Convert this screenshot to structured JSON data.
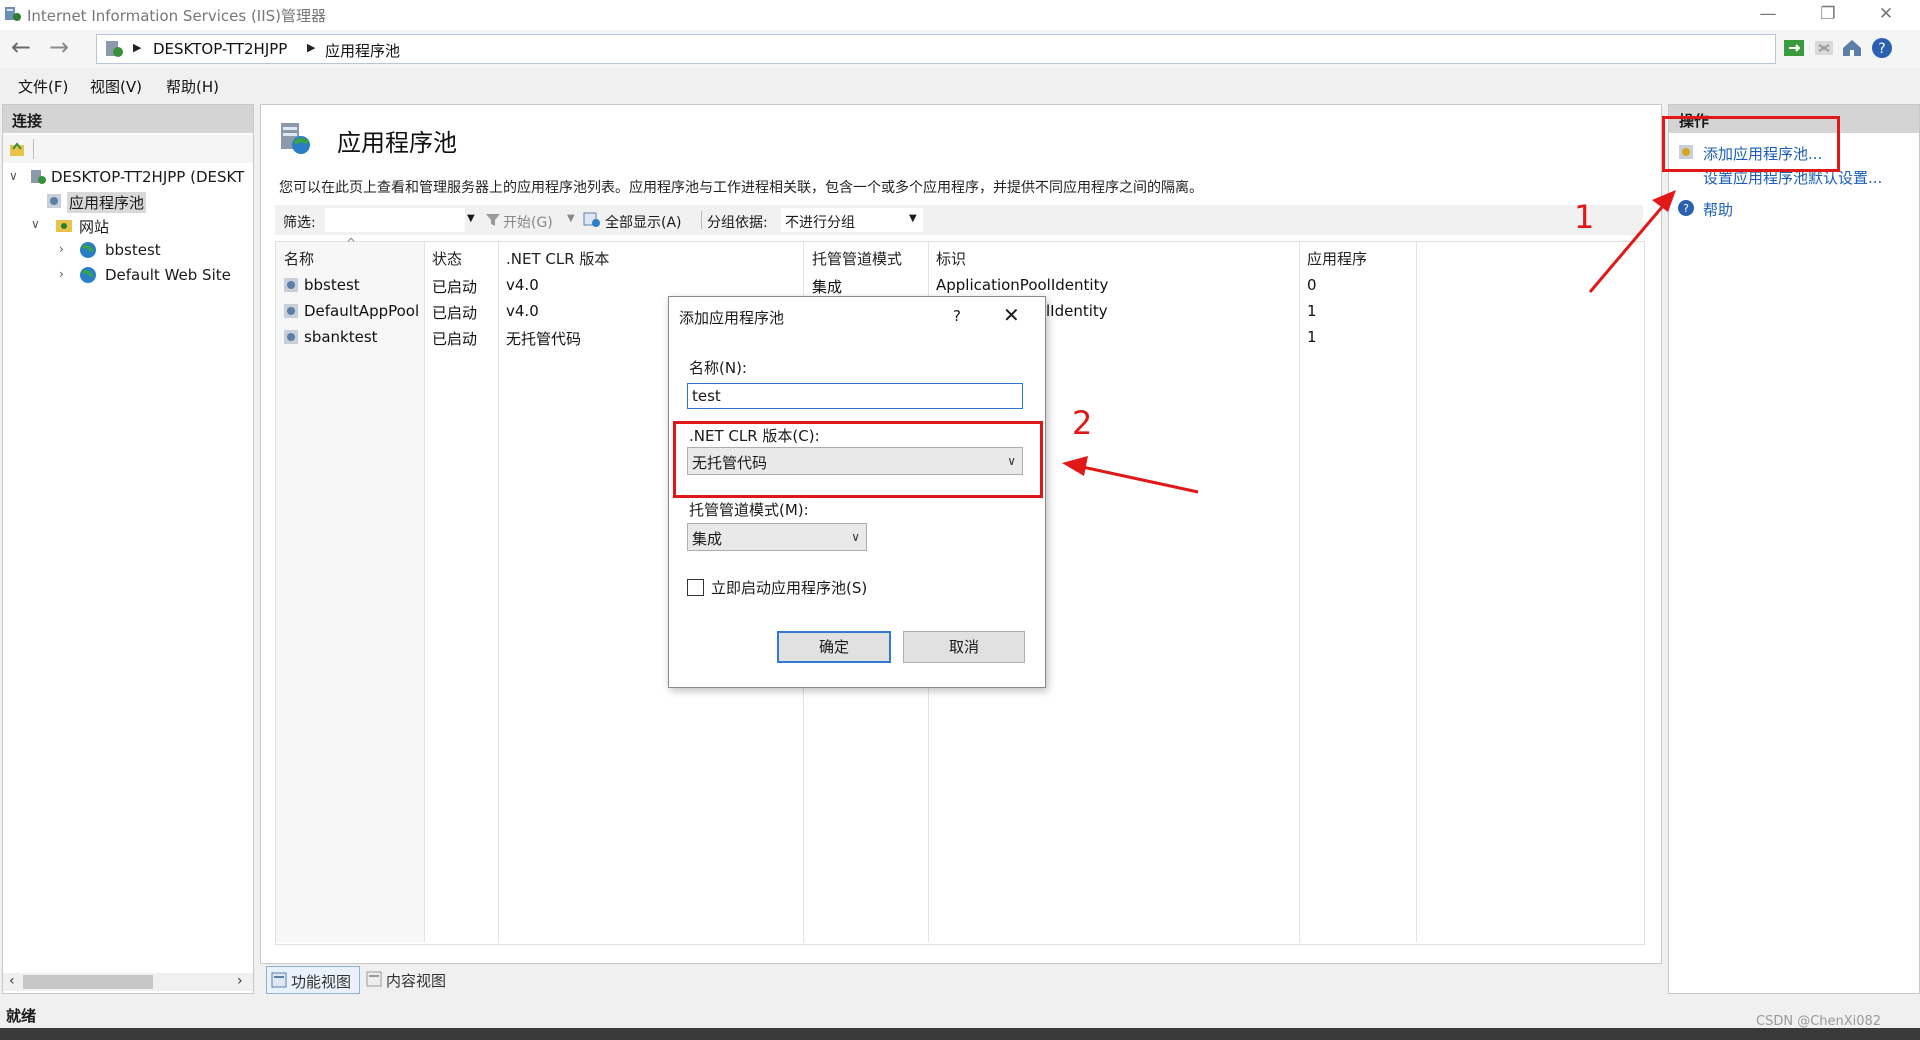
{
  "window": {
    "title": "Internet Information Services (IIS)管理器",
    "min": "—",
    "max": "❐",
    "close": "✕"
  },
  "address": {
    "crumbs": [
      "DESKTOP-TT2HJPP",
      "应用程序池"
    ]
  },
  "menu": {
    "items": [
      "文件(F)",
      "视图(V)",
      "帮助(H)"
    ]
  },
  "connections": {
    "title": "连接",
    "tree": [
      {
        "label": "DESKTOP-TT2HJPP (DESKT",
        "expanded": true
      },
      {
        "label": "应用程序池",
        "selected": true
      },
      {
        "label": "网站",
        "expanded": true
      },
      {
        "label": "bbstest"
      },
      {
        "label": "Default Web Site"
      }
    ]
  },
  "main": {
    "title": "应用程序池",
    "description": "您可以在此页上查看和管理服务器上的应用程序池列表。应用程序池与工作进程相关联，包含一个或多个应用程序，并提供不同应用程序之间的隔离。",
    "filter_label": "筛选:",
    "start_label": "开始(G)",
    "show_all_label": "全部显示(A)",
    "group_by_label": "分组依据:",
    "group_by_value": "不进行分组",
    "columns": [
      "名称",
      "状态",
      ".NET CLR 版本",
      "托管管道模式",
      "标识",
      "应用程序"
    ],
    "rows": [
      {
        "name": "bbstest",
        "status": "已启动",
        "clr": "v4.0",
        "mode": "集成",
        "identity": "ApplicationPoolIdentity",
        "apps": "0"
      },
      {
        "name": "DefaultAppPool",
        "status": "已启动",
        "clr": "v4.0",
        "mode": "",
        "identity": "lIdentity",
        "apps": "1"
      },
      {
        "name": "sbanktest",
        "status": "已启动",
        "clr": "无托管代码",
        "mode": "",
        "identity": "",
        "apps": "1"
      }
    ],
    "tabs": {
      "features": "功能视图",
      "content": "内容视图"
    }
  },
  "actions": {
    "title": "操作",
    "add": "添加应用程序池...",
    "defaults": "设置应用程序池默认设置...",
    "help": "帮助"
  },
  "status": {
    "text": "就绪"
  },
  "watermark": "CSDN @ChenXi082",
  "dialog": {
    "title": "添加应用程序池",
    "help": "?",
    "close": "✕",
    "name_label": "名称(N):",
    "name_value": "test",
    "clr_label": ".NET CLR 版本(C):",
    "clr_value": "无托管代码",
    "mode_label": "托管管道模式(M):",
    "mode_value": "集成",
    "start_label": "立即启动应用程序池(S)",
    "start_checked": false,
    "ok": "确定",
    "cancel": "取消"
  },
  "annotations": {
    "one": "1",
    "two": "2",
    "color": "#e01818"
  }
}
